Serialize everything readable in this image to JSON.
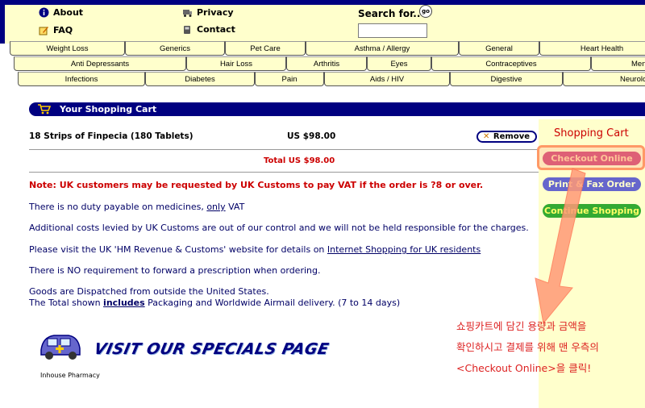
{
  "header": {
    "links": {
      "about": "About",
      "faq": "FAQ",
      "privacy": "Privacy",
      "contact": "Contact"
    },
    "search": {
      "label": "Search for..",
      "go": "go",
      "value": ""
    }
  },
  "nav": {
    "row1": [
      "Weight Loss",
      "Generics",
      "Pet Care",
      "Asthma / Allergy",
      "General",
      "Heart Health"
    ],
    "row2": [
      "Anti Depressants",
      "Hair Loss",
      "Arthritis",
      "Eyes",
      "Contraceptives",
      "Men"
    ],
    "row3": [
      "Infections",
      "Diabetes",
      "Pain",
      "Aids / HIV",
      "Digestive",
      "Neurolo"
    ]
  },
  "cart": {
    "title": "Your Shopping Cart",
    "items": [
      {
        "name": "18 Strips of Finpecia (180 Tablets)",
        "price": "US $98.00",
        "remove": "Remove"
      }
    ],
    "total": "Total US $98.00"
  },
  "notes": {
    "vat_warning": "Note: UK customers may be requested by UK Customs to pay VAT if the order is ?8 or over.",
    "duty_prefix": "There is no duty payable on medicines, ",
    "duty_link": "only",
    "duty_suffix": " VAT",
    "additional_costs": "Additional costs levied by UK Customs are out of our control and we will not be held responsible for the charges.",
    "visit_prefix": "Please visit the UK 'HM Revenue & Customs' website for details on ",
    "visit_link": "Internet Shopping for UK residents",
    "prescription": "There is NO requirement to forward a prescription when ordering.",
    "dispatched": "Goods are Dispatched from outside the United States.",
    "total_prefix": "The Total shown ",
    "total_link": "includes",
    "total_suffix": " Packaging and Worldwide Airmail delivery. (7 to 14 days)"
  },
  "sidebar": {
    "title": "Shopping Cart",
    "checkout": "Checkout Online",
    "print_fax": "Print & Fax Order",
    "continue": "Continue Shopping"
  },
  "annotation": {
    "line1": "쇼핑카트에 담긴 용량과 금액을",
    "line2": "확인하시고 결제를 위해 맨 우측의",
    "line3": "<Checkout Online>을 클릭!"
  },
  "specials": {
    "banner": "VISIT OUR SPECIALS PAGE",
    "pharmacy": "Inhouse Pharmacy"
  },
  "colors": {
    "navy": "#000080",
    "pale_yellow": "#ffffcc",
    "red": "#cc0000",
    "checkout": "#cc3366",
    "print": "#6666cc",
    "continue": "#33aa33"
  }
}
